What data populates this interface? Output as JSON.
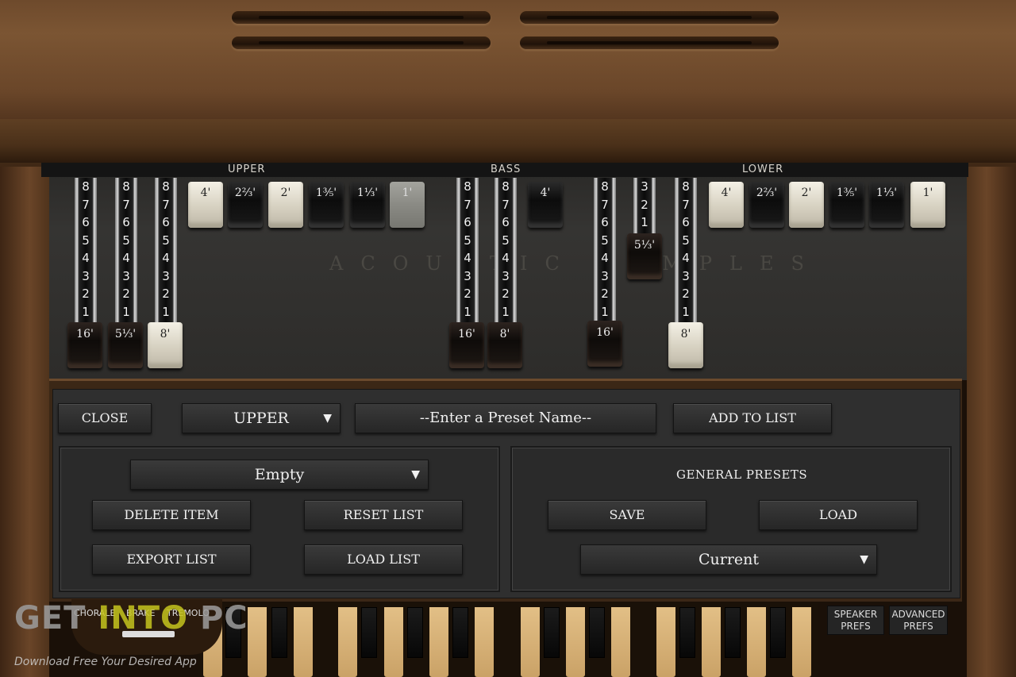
{
  "sections": {
    "upper": "UPPER",
    "bass": "BASS",
    "lower": "LOWER"
  },
  "watermark": "ACOUSTIC SAMPLES",
  "drawbar_numbers": [
    "8",
    "7",
    "6",
    "5",
    "4",
    "3",
    "2",
    "1"
  ],
  "short_bar_numbers": [
    "3",
    "2",
    "1"
  ],
  "upper": {
    "bars": [
      {
        "label": "16'"
      },
      {
        "label": "5⅓'"
      },
      {
        "label": "8'"
      }
    ],
    "tabs": [
      "4'",
      "2⅔'",
      "2'",
      "1⅗'",
      "1⅓'",
      "1'"
    ]
  },
  "bass": {
    "bars": [
      {
        "label": "16'"
      },
      {
        "label": "8'"
      }
    ],
    "tabs": [
      "4'"
    ]
  },
  "lower": {
    "bars": [
      {
        "label": "16'"
      },
      {
        "label": "5⅓'"
      },
      {
        "label": "8'"
      }
    ],
    "tabs": [
      "4'",
      "2⅔'",
      "2'",
      "1⅗'",
      "1⅓'",
      "1'"
    ]
  },
  "toolbar": {
    "close": "CLOSE",
    "manual_select": "UPPER",
    "preset_name_placeholder": "--Enter a Preset Name--",
    "add_to_list": "ADD TO LIST"
  },
  "list_panel": {
    "list_select": "Empty",
    "delete_item": "DELETE ITEM",
    "reset_list": "RESET LIST",
    "export_list": "EXPORT LIST",
    "load_list": "LOAD LIST"
  },
  "general_presets": {
    "title": "GENERAL PRESETS",
    "save": "SAVE",
    "load": "LOAD",
    "current_select": "Current"
  },
  "bottom": {
    "chorale": "CHORALE",
    "brake": "BRAKE",
    "tremolo": "TREMOLO",
    "speaker_prefs_1": "SPEAKER",
    "speaker_prefs_2": "PREFS",
    "advanced_prefs_1": "ADVANCED",
    "advanced_prefs_2": "PREFS"
  },
  "overlay": {
    "logo_get": "GET",
    "logo_into": "INTO",
    "logo_pc": "PC",
    "tagline": "Download Free Your Desired App"
  }
}
